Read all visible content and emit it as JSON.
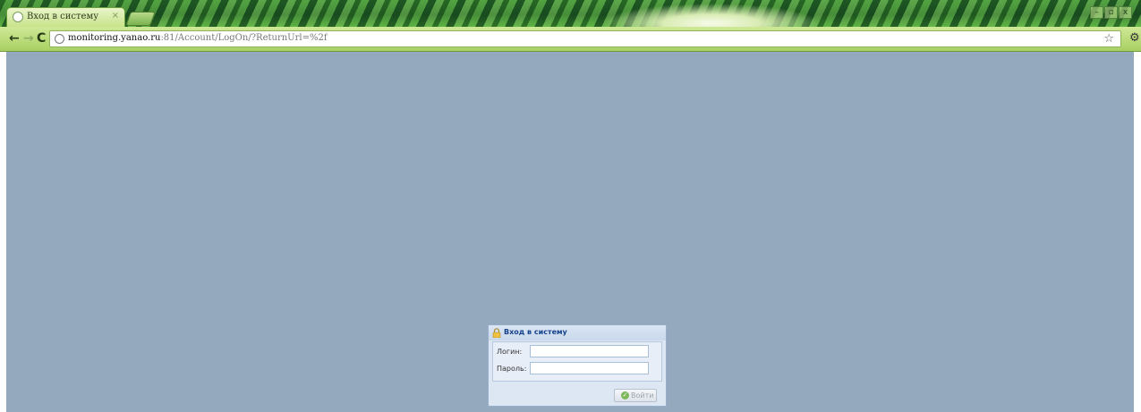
{
  "browser": {
    "tab": {
      "title": "Вход в систему",
      "close_glyph": "×"
    },
    "window_controls": {
      "minimize": "–",
      "restore": "▫",
      "close": "x"
    },
    "nav": {
      "back": "←",
      "forward": "→",
      "reload": "C"
    },
    "url": {
      "host": "monitoring.yanao.ru",
      "rest": ":81/Account/LogOn/?ReturnUrl=%2f"
    },
    "icons": [
      "globe-icon",
      "star-icon",
      "wrench-icon"
    ],
    "star_glyph": "☆",
    "wrench_glyph": "🔧"
  },
  "login": {
    "title": "Вход в систему",
    "login_label": "Логин:",
    "login_value": "",
    "password_label": "Пароль:",
    "password_value": "",
    "submit_label": "Войти"
  },
  "colors": {
    "page_background": "#94a8be",
    "panel_title": "#15428b"
  }
}
